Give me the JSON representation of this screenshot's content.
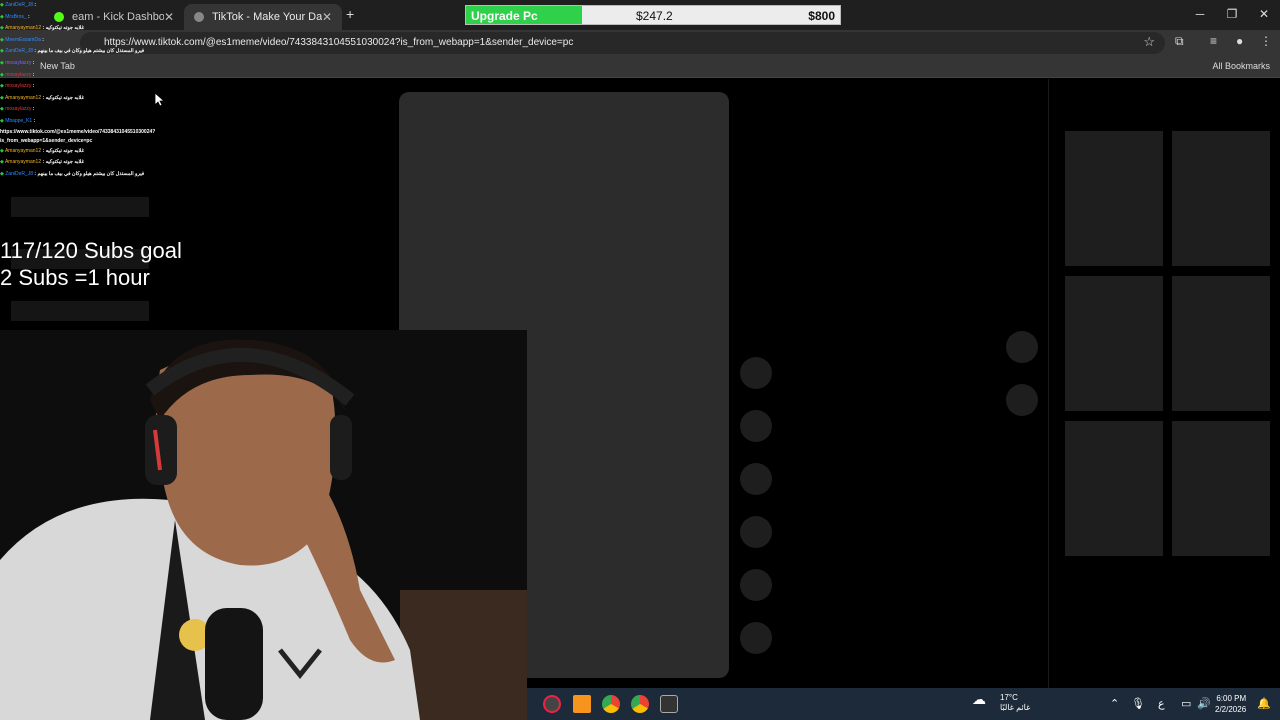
{
  "browser": {
    "tabs": [
      {
        "label": "eam - Kick Dashboard",
        "active": false
      },
      {
        "label": "TikTok - Make Your Day",
        "active": true
      }
    ],
    "url": "https://www.tiktok.com/@es1meme/video/7433843104551030024?is_from_webapp=1&sender_device=pc",
    "bookmarks": {
      "new_tab": "New Tab",
      "all_bookmarks": "All Bookmarks"
    }
  },
  "goal": {
    "label": "Upgrade Pc",
    "current": "$247.2",
    "target": "$800",
    "progress_fraction": 0.309,
    "fill_color": "#2fd14a"
  },
  "chat": {
    "messages": [
      {
        "user": "ZaniDeR_J8",
        "text": "",
        "user_color": "#2f8cff"
      },
      {
        "user": "MrsBros_",
        "text": "",
        "user_color": "#2f8cff"
      },
      {
        "user": "Amanyayman12",
        "text": "غلابه جوته تيكتوكيه",
        "user_color": "#f0b429"
      },
      {
        "user": "MeemEssamDa",
        "text": "",
        "user_color": "#2f8cff"
      },
      {
        "user": "ZaniDeR_J8",
        "text": "فيرو المستذل كان بيشتم هيلو وكان في بيف ما بينهم",
        "user_color": "#2f8cff"
      },
      {
        "user": "mosaylazzy",
        "text": "",
        "user_color": "#7b61ff"
      },
      {
        "user": "mosaylazzy",
        "text": "",
        "user_color": "#e03a3a"
      },
      {
        "user": "mosaylazzy",
        "text": "",
        "user_color": "#e03a3a"
      },
      {
        "user": "Amanyayman12",
        "text": "غلابه جوته تيكتوكيه",
        "user_color": "#f0b429"
      },
      {
        "user": "mosaylazzy",
        "text": "",
        "user_color": "#e03a3a"
      },
      {
        "user": "Mbappe_K1",
        "text": "https://www.tiktok.com/@es1meme/video/7433843104551030024?is_from_webapp=1&sender_device=pc",
        "user_color": "#2f8cff"
      },
      {
        "user": "Amanyayman12",
        "text": "غلابه جوته تيكتوكيه",
        "user_color": "#f0b429"
      },
      {
        "user": "Amanyayman12",
        "text": "غلابه جوته تيكتوكيه",
        "user_color": "#f0b429"
      },
      {
        "user": "ZaniDeR_J8",
        "text": "فيرو المستذل كان بيشتم هيلو وكان في بيف ما بينهم",
        "user_color": "#2f8cff"
      }
    ]
  },
  "overlay": {
    "subs_goal": "117/120 Subs goal",
    "subs_rule": "2 Subs =1 hour"
  },
  "taskbar": {
    "weather_temp": "17°C",
    "weather_desc": "غائم غالبًا",
    "time": "6:00 PM",
    "date": "2/2/2026",
    "lang": "ع"
  }
}
